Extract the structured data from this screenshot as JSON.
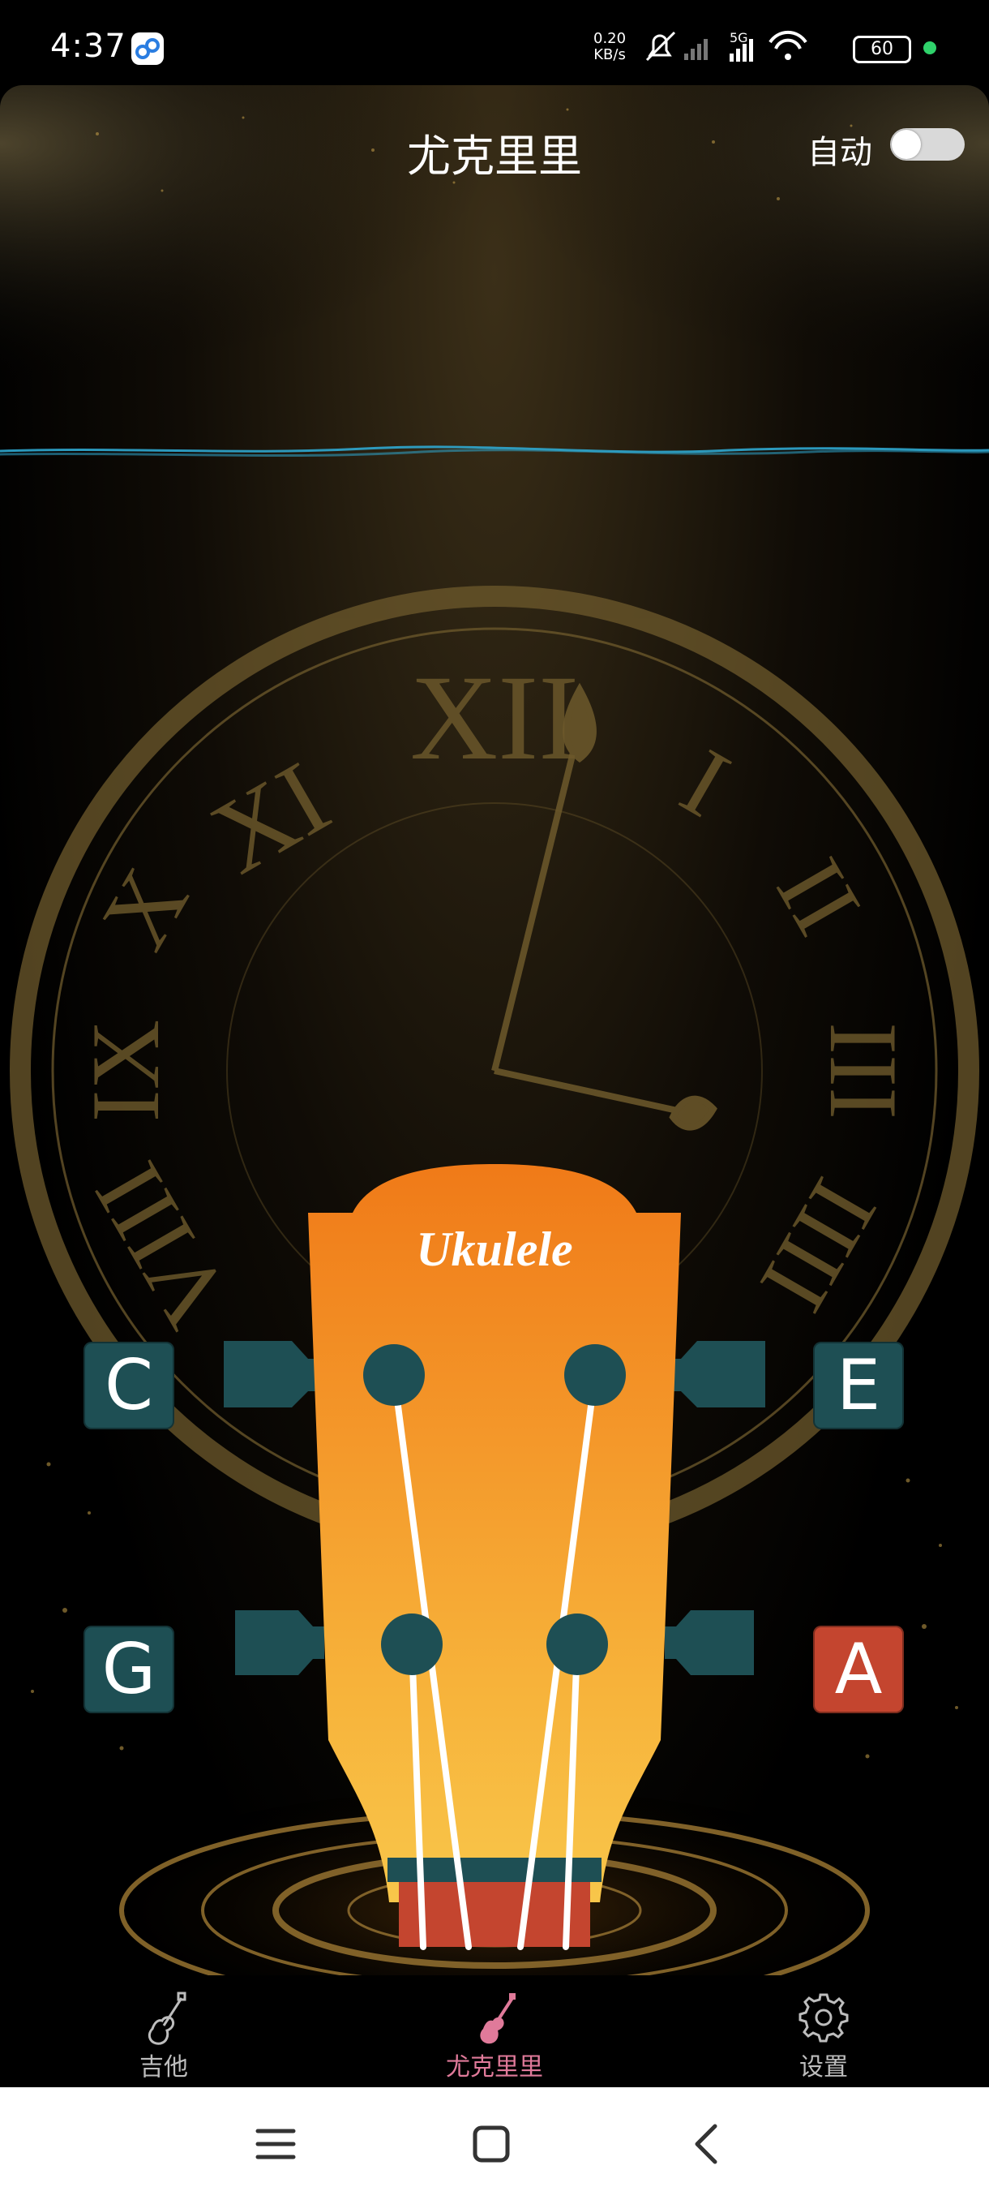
{
  "status_bar": {
    "time": "4:37",
    "net_speed_value": "0.20",
    "net_speed_unit": "KB/s",
    "network_type": "5G",
    "battery": "60"
  },
  "header": {
    "title": "尤克里里",
    "auto_label": "自动",
    "auto_enabled": false
  },
  "headstock": {
    "brand_text": "Ukulele"
  },
  "strings": [
    {
      "note": "C",
      "active": false
    },
    {
      "note": "E",
      "active": false
    },
    {
      "note": "G",
      "active": false
    },
    {
      "note": "A",
      "active": true
    }
  ],
  "bottom_nav": {
    "tabs": [
      {
        "label": "吉他",
        "icon": "guitar-icon",
        "active": false
      },
      {
        "label": "尤克里里",
        "icon": "ukulele-icon",
        "active": true
      },
      {
        "label": "设置",
        "icon": "gear-icon",
        "active": false
      }
    ]
  },
  "colors": {
    "accent_active_tab": "#e07a9a",
    "string_button": "#1e4f54",
    "string_button_active": "#c4452f",
    "headstock_orange": "#f07a18",
    "waveform": "#2fa8d0"
  }
}
